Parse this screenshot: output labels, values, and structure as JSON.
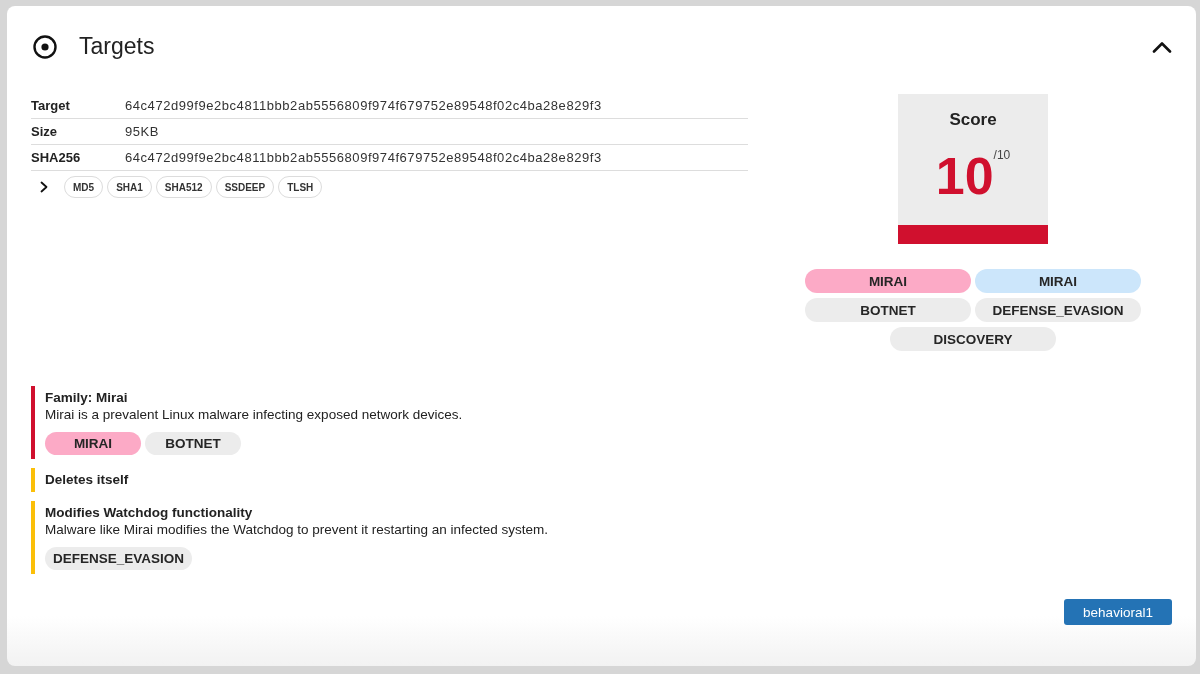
{
  "panel": {
    "title": "Targets",
    "expanded": true
  },
  "details": {
    "rows": [
      {
        "label": "Target",
        "value": "64c472d99f9e2bc4811bbb2ab5556809f974f679752e89548f02c4ba28e829f3"
      },
      {
        "label": "Size",
        "value": "95KB"
      },
      {
        "label": "SHA256",
        "value": "64c472d99f9e2bc4811bbb2ab5556809f974f679752e89548f02c4ba28e829f3"
      }
    ],
    "hashes": {
      "expanded": false,
      "items": [
        "MD5",
        "SHA1",
        "SHA512",
        "SSDEEP",
        "TLSH"
      ]
    }
  },
  "score": {
    "label": "Score",
    "value": "10",
    "max": "/10"
  },
  "tags": [
    {
      "label": "MIRAI",
      "color": "#fcaac6"
    },
    {
      "label": "MIRAI",
      "color": "#cce6fb"
    },
    {
      "label": "BOTNET",
      "color": "#ececec"
    },
    {
      "label": "DEFENSE_EVASION",
      "color": "#ececec"
    },
    {
      "label": "DISCOVERY",
      "color": "#ececec"
    }
  ],
  "signatures": [
    {
      "title": "Family: Mirai",
      "description": "Mirai is a prevalent Linux malware infecting exposed network devices.",
      "color": "#d0102e",
      "tags": [
        {
          "label": "MIRAI",
          "color": "#fcaac6"
        },
        {
          "label": "BOTNET",
          "color": "#ececec"
        }
      ]
    },
    {
      "title": "Deletes itself",
      "color": "#fbbf08"
    },
    {
      "title": "Modifies Watchdog functionality",
      "description": "Malware like Mirai modifies the Watchdog to prevent it restarting an infected system.",
      "color": "#fbbf08",
      "tags": [
        {
          "label": "DEFENSE_EVASION",
          "color": "#ececec"
        }
      ]
    }
  ],
  "task_button": {
    "label": "behavioral1"
  }
}
